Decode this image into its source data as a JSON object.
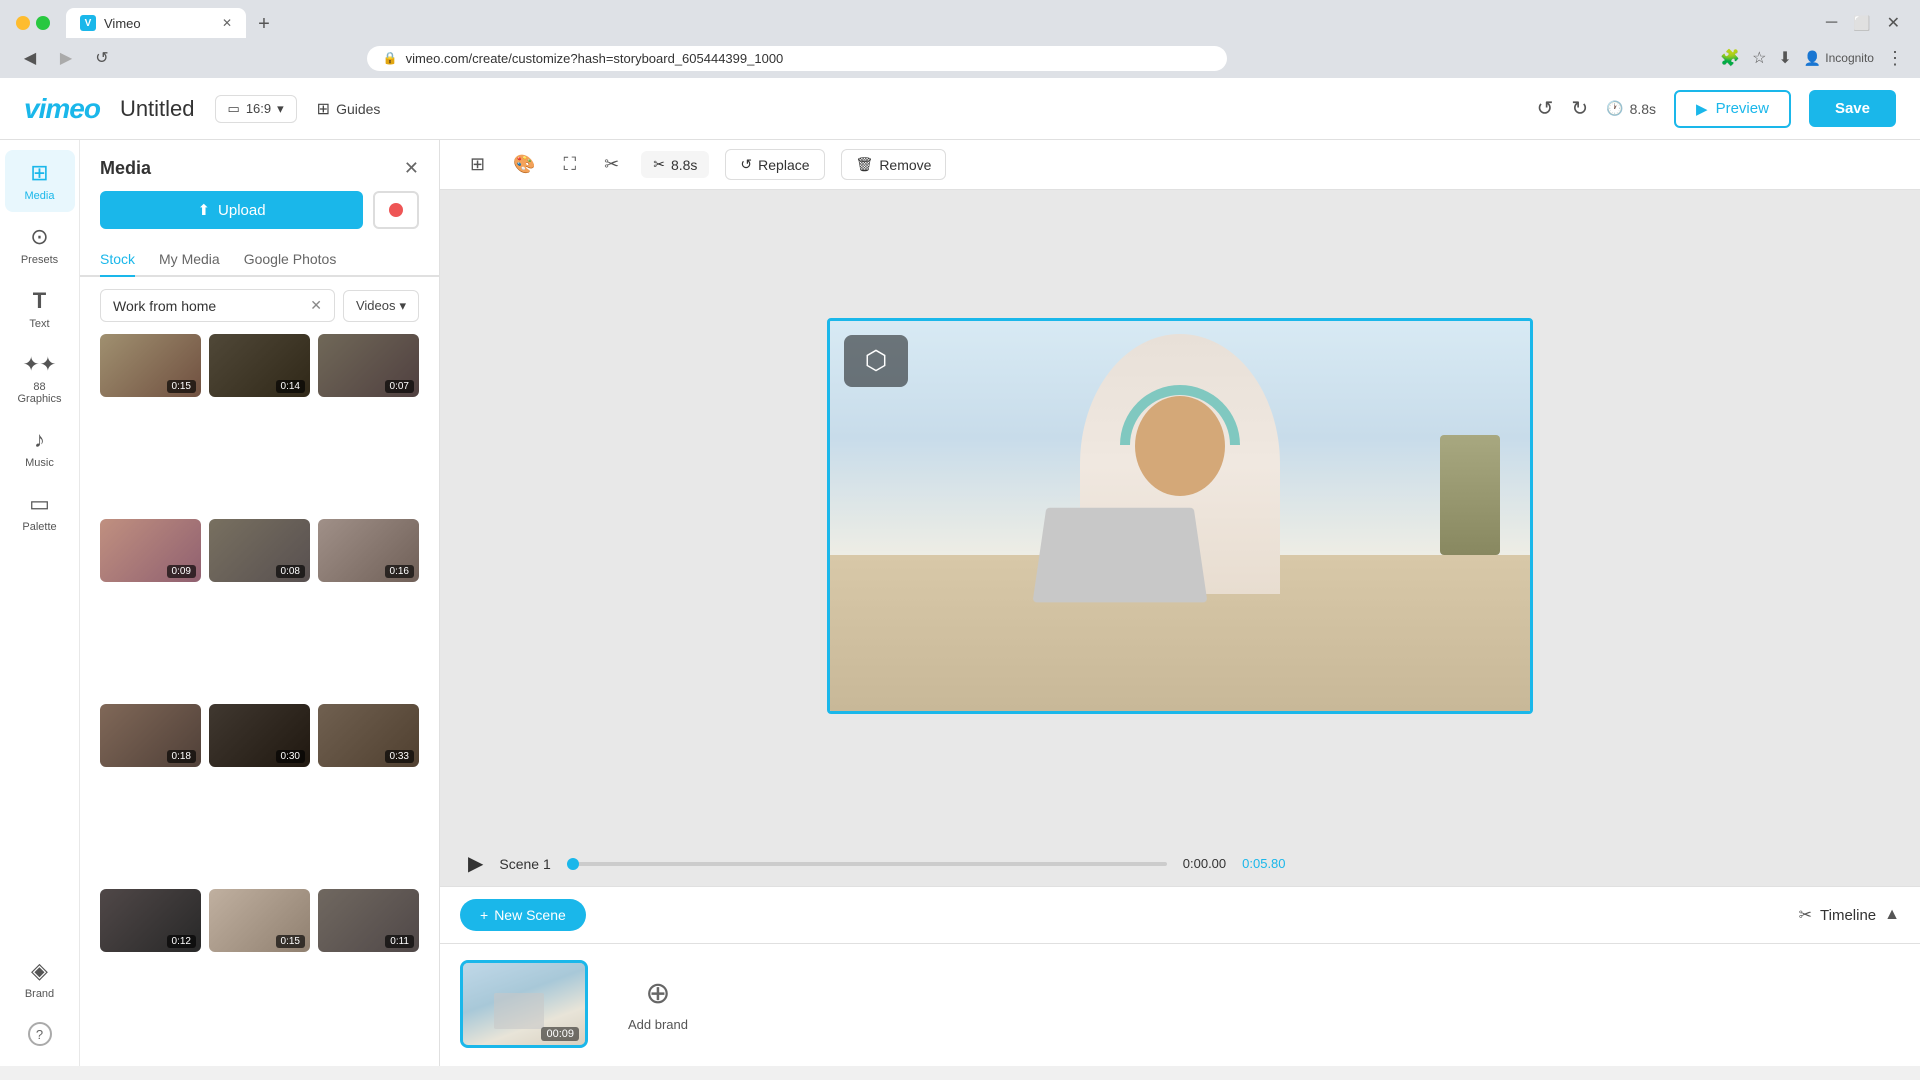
{
  "browser": {
    "tab_title": "Vimeo",
    "url": "vimeo.com/create/customize?hash=storyboard_605444399_1000",
    "incognito_label": "Incognito"
  },
  "topbar": {
    "logo": "vimeo",
    "project_title": "Untitled",
    "aspect_ratio": "16:9",
    "guides_label": "Guides",
    "time_label": "8.8s",
    "preview_label": "Preview",
    "save_label": "Save"
  },
  "icon_sidebar": {
    "items": [
      {
        "id": "media",
        "label": "Media",
        "icon": "⊞",
        "active": true
      },
      {
        "id": "presets",
        "label": "Presets",
        "icon": "⊙"
      },
      {
        "id": "text",
        "label": "Text",
        "icon": "T"
      },
      {
        "id": "graphics",
        "label": "88 Graphics",
        "icon": "✦"
      },
      {
        "id": "music",
        "label": "Music",
        "icon": "♪"
      },
      {
        "id": "palette",
        "label": "Palette",
        "icon": "▭"
      },
      {
        "id": "brand",
        "label": "Brand",
        "icon": "◈"
      }
    ]
  },
  "media_panel": {
    "title": "Media",
    "upload_label": "Upload",
    "tabs": [
      {
        "id": "stock",
        "label": "Stock",
        "active": true
      },
      {
        "id": "my_media",
        "label": "My Media"
      },
      {
        "id": "google_photos",
        "label": "Google Photos"
      }
    ],
    "search_value": "Work from home",
    "filter_label": "Videos",
    "thumbnails": [
      {
        "id": 1,
        "duration": "0:15",
        "color": "t1"
      },
      {
        "id": 2,
        "duration": "0:14",
        "color": "t2"
      },
      {
        "id": 3,
        "duration": "0:07",
        "color": "t3"
      },
      {
        "id": 4,
        "duration": "0:09",
        "color": "t4"
      },
      {
        "id": 5,
        "duration": "0:08",
        "color": "t5"
      },
      {
        "id": 6,
        "duration": "0:16",
        "color": "t6"
      },
      {
        "id": 7,
        "duration": "0:18",
        "color": "t7"
      },
      {
        "id": 8,
        "duration": "0:30",
        "color": "t8"
      },
      {
        "id": 9,
        "duration": "0:33",
        "color": "t9"
      },
      {
        "id": 10,
        "duration": "0:12",
        "color": "t10"
      },
      {
        "id": 11,
        "duration": "0:15",
        "color": "t11"
      },
      {
        "id": 12,
        "duration": "0:11",
        "color": "t12"
      }
    ]
  },
  "canvas": {
    "time_label": "8.8s",
    "replace_label": "Replace",
    "remove_label": "Remove",
    "scene_label": "Scene 1",
    "time_current": "0:00.00",
    "time_total": "0:05.80"
  },
  "timeline": {
    "new_scene_label": "+ New Scene",
    "timeline_label": "Timeline",
    "scene_duration": "00:09",
    "add_brand_label": "Add brand"
  }
}
